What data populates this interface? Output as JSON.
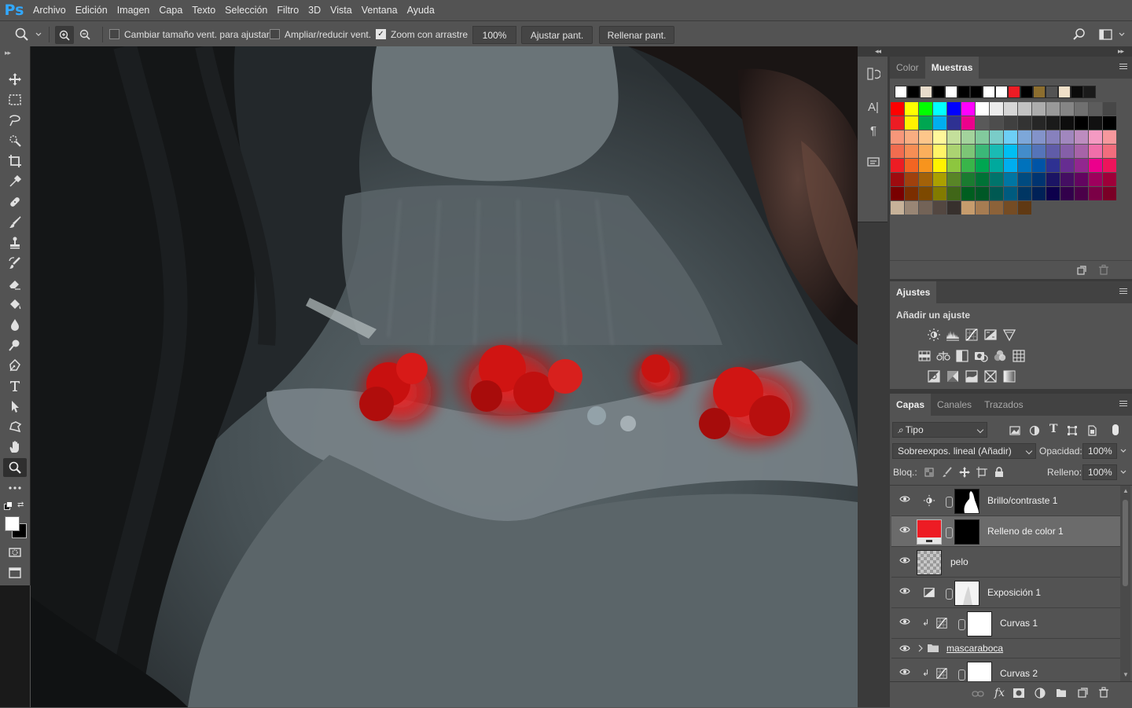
{
  "app": {
    "logo": "Ps"
  },
  "menu": [
    "Archivo",
    "Edición",
    "Imagen",
    "Capa",
    "Texto",
    "Selección",
    "Filtro",
    "3D",
    "Vista",
    "Ventana",
    "Ayuda"
  ],
  "options": {
    "resize_windows_label": "Cambiar tamaño vent. para ajustar",
    "resize_windows_checked": false,
    "zoom_all_label": "Ampliar/reducir vent.",
    "zoom_all_checked": false,
    "scrubby_zoom_label": "Zoom con arrastre",
    "scrubby_zoom_checked": true,
    "zoom_value": "100%",
    "fit_screen_label": "Ajustar pant.",
    "fill_screen_label": "Rellenar pant."
  },
  "tools": [
    "move-tool",
    "marquee-tool",
    "lasso-tool",
    "quick-selection-tool",
    "crop-tool",
    "eyedropper-tool",
    "healing-brush-tool",
    "brush-tool",
    "clone-stamp-tool",
    "history-brush-tool",
    "eraser-tool",
    "paint-bucket-tool",
    "blur-tool",
    "dodge-tool",
    "pen-tool",
    "type-tool",
    "path-selection-tool",
    "custom-shape-tool",
    "hand-tool",
    "zoom-tool",
    "more-tools"
  ],
  "active_tool": "zoom-tool",
  "colors": {
    "foreground": "#ffffff",
    "background": "#000000",
    "accent": "#31a8ff"
  },
  "swatches_panel": {
    "tabs": [
      "Color",
      "Muestras"
    ],
    "active_tab": "Muestras",
    "recent": [
      "#ffffff",
      "#000000",
      "#e8dccb",
      "#000000",
      "#ffffff",
      "#000000",
      "#000000",
      "#ffffff",
      "#ffffff",
      "#ed1c24",
      "#000000",
      "#8c6e2f",
      "#535353",
      "#f0e0c8",
      "#0a0a0a",
      "#1a1a1a"
    ],
    "grid": [
      [
        "#ff0000",
        "#ffff00",
        "#00ff00",
        "#00ffff",
        "#0000ff",
        "#ff00ff",
        "#ffffff",
        "#ebebeb",
        "#d6d6d6",
        "#c2c2c2",
        "#adadad",
        "#999999",
        "#858585",
        "#707070",
        "#5c5c5c",
        "#474747"
      ],
      [
        "#ed1c24",
        "#fff200",
        "#00a651",
        "#00aeef",
        "#2e3192",
        "#ec008c",
        "#595959",
        "#4d4d4d",
        "#404040",
        "#333333",
        "#262626",
        "#1a1a1a",
        "#0d0d0d",
        "#000000",
        "#111111",
        "#000000"
      ],
      [
        "#f7977a",
        "#f9ad81",
        "#fdc68a",
        "#fff79a",
        "#c4df9b",
        "#a3d39c",
        "#82ca9d",
        "#7accc8",
        "#6dcff6",
        "#7da7d9",
        "#8393ca",
        "#8781bd",
        "#a187be",
        "#bd8cbf",
        "#f49ac2",
        "#f6989d"
      ],
      [
        "#f26c4f",
        "#f68e55",
        "#fbaf5c",
        "#fff467",
        "#acd372",
        "#7cc576",
        "#3bb878",
        "#1abbb4",
        "#00bff3",
        "#438cca",
        "#5574b9",
        "#605ca8",
        "#855fa8",
        "#a763a8",
        "#f06ea9",
        "#f26d7d"
      ],
      [
        "#ed1c24",
        "#f26522",
        "#f7941d",
        "#fff200",
        "#8dc63f",
        "#39b54a",
        "#00a651",
        "#00a99d",
        "#00aeef",
        "#0072bc",
        "#0054a6",
        "#2e3192",
        "#662d91",
        "#92278f",
        "#ec008c",
        "#ed145b"
      ],
      [
        "#9e0b0f",
        "#a0410d",
        "#a36209",
        "#aba000",
        "#598527",
        "#1a7b30",
        "#007236",
        "#00746b",
        "#0076a3",
        "#004b80",
        "#003471",
        "#1b1464",
        "#440e62",
        "#630460",
        "#9e005d",
        "#9e0039"
      ],
      [
        "#790000",
        "#7b2e00",
        "#7d4900",
        "#827b00",
        "#406618",
        "#005e20",
        "#005826",
        "#005952",
        "#005b7f",
        "#003663",
        "#002157",
        "#0d004c",
        "#32004b",
        "#4b0049",
        "#7b0046",
        "#7a0026"
      ],
      [
        "#c7b299",
        "#998675",
        "#736357",
        "#534741",
        "#37302d",
        "#c69c6d",
        "#a67c52",
        "#8c6239",
        "#754c24",
        "#603913"
      ]
    ]
  },
  "adjustments_panel": {
    "title": "Ajustes",
    "subtitle": "Añadir un ajuste",
    "row1": [
      "brightness-contrast-icon",
      "levels-icon",
      "curves-icon",
      "exposure-icon",
      "vibrance-icon"
    ],
    "row2": [
      "hue-saturation-icon",
      "color-balance-icon",
      "black-white-icon",
      "photo-filter-icon",
      "channel-mixer-icon",
      "color-lookup-icon"
    ],
    "row3": [
      "invert-icon",
      "posterize-icon",
      "threshold-icon",
      "selective-color-icon",
      "gradient-map-icon"
    ]
  },
  "layers_panel": {
    "tabs": [
      "Capas",
      "Canales",
      "Trazados"
    ],
    "active_tab": "Capas",
    "filter_label": "Tipo",
    "blend_mode": "Sobreexpos. lineal (Añadir)",
    "opacity_label": "Opacidad:",
    "opacity_value": "100%",
    "lock_label": "Bloq.:",
    "fill_label": "Relleno:",
    "fill_value": "100%",
    "layers": [
      {
        "name": "Brillo/contraste 1",
        "kind": "brightness-adjustment",
        "selected": false
      },
      {
        "name": "Relleno de color 1",
        "kind": "color-fill",
        "fill_color": "#ed1c24",
        "selected": true
      },
      {
        "name": "pelo",
        "kind": "pixel",
        "selected": false
      },
      {
        "name": "Exposición 1",
        "kind": "exposure-adjustment",
        "selected": false
      },
      {
        "name": "Curvas 1",
        "kind": "curves-adjustment",
        "clipped": true,
        "selected": false
      },
      {
        "name": "mascaraboca",
        "kind": "group",
        "selected": false
      },
      {
        "name": "Curvas 2",
        "kind": "curves-adjustment",
        "clipped": true,
        "selected": false
      }
    ]
  }
}
